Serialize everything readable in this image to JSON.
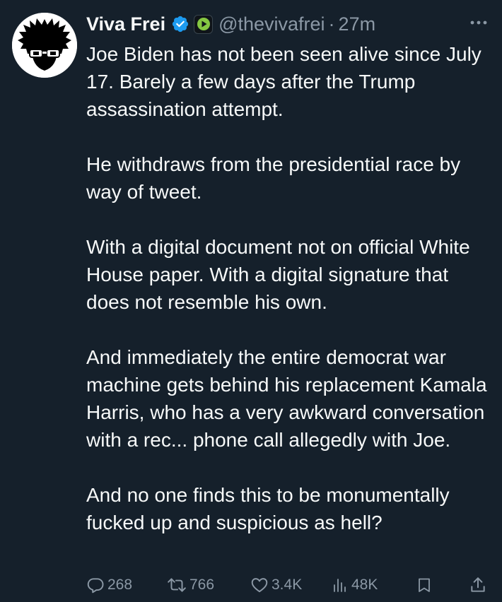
{
  "author": {
    "name": "Viva Frei",
    "handle": "@thevivafrei",
    "separator": "·",
    "time": "27m"
  },
  "icons": {
    "verified": "verified-badge-icon",
    "affiliate": "rumble-play-icon",
    "more": "more-horizontal-icon"
  },
  "colors": {
    "background": "#15202b",
    "text": "#f7f9f9",
    "muted": "#8b98a5",
    "verified": "#1d9bf0",
    "affiliate": "#85c742"
  },
  "tweet": {
    "paragraphs": [
      "Joe Biden has not been seen alive since July 17. Barely a few days after the Trump assassination attempt.",
      "He withdraws from the presidential race by way of tweet.",
      "With a digital document not on official White House paper. With a digital signature that does not resemble his own.",
      "And immediately the entire democrat war machine gets behind his replacement Kamala Harris, who has a very awkward conversation with a rec... phone call allegedly with Joe.",
      "And no one finds this to be monumentally fucked up and suspicious as hell?"
    ]
  },
  "actions": {
    "replies": "268",
    "retweets": "766",
    "likes": "3.4K",
    "views": "48K"
  }
}
